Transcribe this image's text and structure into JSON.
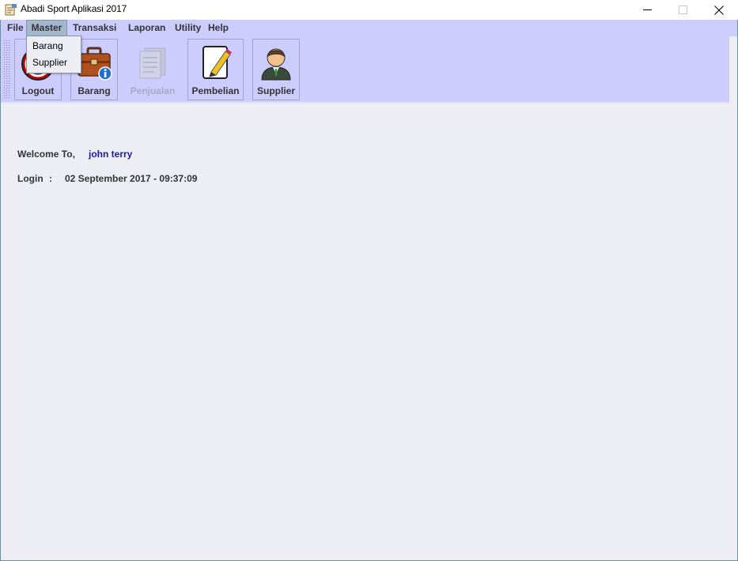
{
  "window": {
    "title": "Abadi Sport Aplikasi 2017",
    "minimize_icon": "minimize-icon",
    "maximize_icon": "maximize-icon",
    "close_icon": "close-icon"
  },
  "menubar": {
    "items": [
      "File",
      "Master",
      "Transaksi",
      "Laporan",
      "Utility",
      "Help"
    ],
    "active": "Master"
  },
  "master_menu": {
    "items": [
      "Barang",
      "Supplier"
    ]
  },
  "toolbar": {
    "buttons": [
      {
        "label": "Logout",
        "icon": "logout-icon",
        "enabled": true
      },
      {
        "label": "Barang",
        "icon": "briefcase-info-icon",
        "enabled": true
      },
      {
        "label": "Penjualan",
        "icon": "documents-icon",
        "enabled": false
      },
      {
        "label": "Pembelian",
        "icon": "document-pencil-icon",
        "enabled": true
      },
      {
        "label": "Supplier",
        "icon": "person-icon",
        "enabled": true
      }
    ]
  },
  "main": {
    "welcome_label": "Welcome To,",
    "user_name": "john terry",
    "login_label": "Login",
    "login_separator": ":",
    "login_time": "02 September 2017 - 09:37:09"
  },
  "colors": {
    "toolbar_bg": "#ccccff",
    "content_bg": "#eceef3",
    "user_name": "#1a1aa8"
  }
}
